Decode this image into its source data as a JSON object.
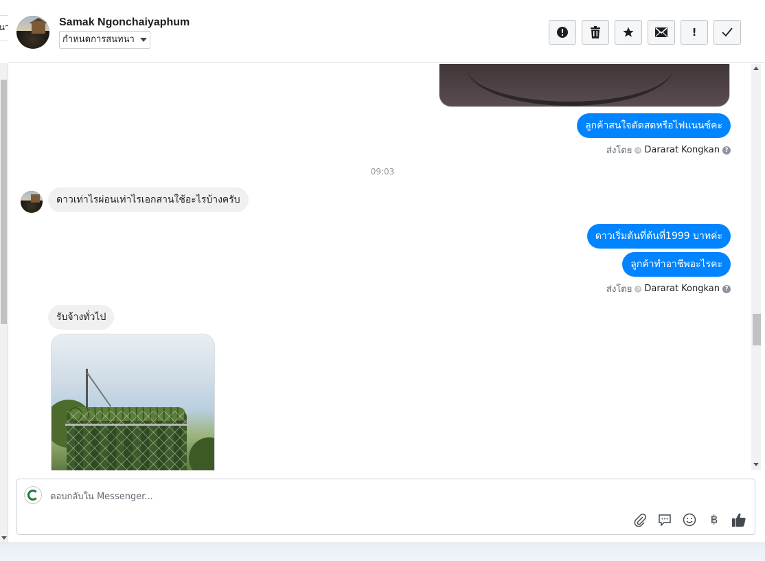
{
  "left_tab": {
    "label": "นา"
  },
  "header": {
    "contact_name": "Samak Ngonchaiyaphum",
    "assign_label": "กำหนดการสนทนา",
    "actions": [
      {
        "name": "spam-icon",
        "glyph": "!"
      },
      {
        "name": "trash-icon",
        "glyph": "🗑"
      },
      {
        "name": "star-icon",
        "glyph": "★"
      },
      {
        "name": "mail-icon",
        "glyph": "✉"
      },
      {
        "name": "follow-up-icon",
        "glyph": "!"
      },
      {
        "name": "done-icon",
        "glyph": "✓"
      }
    ]
  },
  "thread": {
    "msg1": "ลูกค้าสนใจตัดสดหรือไฟแนนซ์คะ",
    "sent_by_label": "ส่งโดย",
    "agent_name": "Dararat Kongkan",
    "time": "09:03",
    "msg2": "ดาวเท่าไรผ่อนเท่าไรเอกสานใช้อะไรบ้างครับ",
    "msg3": "ดาวเริ่มต้นที่ต้นที่1999 บาทค่ะ",
    "msg4": "ลูกค้าทำอาชีพอะไรคะ",
    "msg5": "รับจ้างทั่วไป"
  },
  "composer": {
    "placeholder": "ตอบกลับใน Messenger...",
    "tools": [
      "paperclip-icon",
      "saved-reply-icon",
      "emoji-icon",
      "baht-icon",
      "like-icon"
    ]
  },
  "colors": {
    "accent": "#0084ff",
    "incoming": "#f1f0f0"
  }
}
